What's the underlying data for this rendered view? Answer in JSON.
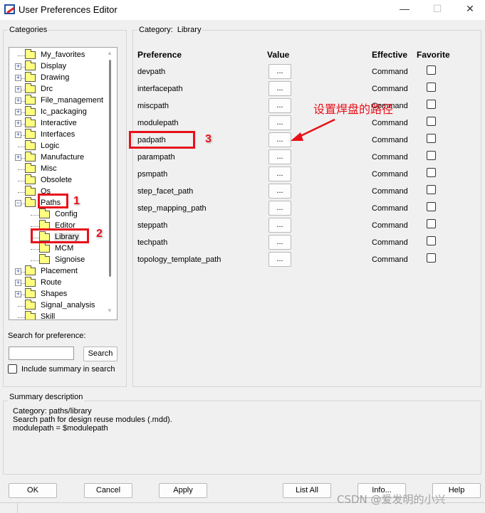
{
  "window": {
    "title": "User Preferences Editor",
    "controls": [
      "—",
      "☐",
      "✕"
    ]
  },
  "categories": {
    "legend": "Categories",
    "items": [
      {
        "label": "My_favorites",
        "level": 0,
        "expander": ""
      },
      {
        "label": "Display",
        "level": 0,
        "expander": "+"
      },
      {
        "label": "Drawing",
        "level": 0,
        "expander": "+"
      },
      {
        "label": "Drc",
        "level": 0,
        "expander": "+"
      },
      {
        "label": "File_management",
        "level": 0,
        "expander": "+"
      },
      {
        "label": "Ic_packaging",
        "level": 0,
        "expander": "+"
      },
      {
        "label": "Interactive",
        "level": 0,
        "expander": "+"
      },
      {
        "label": "Interfaces",
        "level": 0,
        "expander": "+"
      },
      {
        "label": "Logic",
        "level": 0,
        "expander": ""
      },
      {
        "label": "Manufacture",
        "level": 0,
        "expander": "+"
      },
      {
        "label": "Misc",
        "level": 0,
        "expander": ""
      },
      {
        "label": "Obsolete",
        "level": 0,
        "expander": ""
      },
      {
        "label": "Os",
        "level": 0,
        "expander": ""
      },
      {
        "label": "Paths",
        "level": 0,
        "expander": "−"
      },
      {
        "label": "Config",
        "level": 1,
        "expander": ""
      },
      {
        "label": "Editor",
        "level": 1,
        "expander": ""
      },
      {
        "label": "Library",
        "level": 1,
        "expander": "",
        "selected": true
      },
      {
        "label": "MCM",
        "level": 1,
        "expander": ""
      },
      {
        "label": "Signoise",
        "level": 1,
        "expander": ""
      },
      {
        "label": "Placement",
        "level": 0,
        "expander": "+"
      },
      {
        "label": "Route",
        "level": 0,
        "expander": "+"
      },
      {
        "label": "Shapes",
        "level": 0,
        "expander": "+"
      },
      {
        "label": "Signal_analysis",
        "level": 0,
        "expander": ""
      },
      {
        "label": "Skill",
        "level": 0,
        "expander": ""
      }
    ]
  },
  "search": {
    "label": "Search for preference:",
    "value": "",
    "button": "Search",
    "include_summary_label": "Include summary in search",
    "include_summary_checked": false
  },
  "category_panel": {
    "legend_label": "Category:",
    "legend_value": "Library",
    "headers": {
      "preference": "Preference",
      "value": "Value",
      "effective": "Effective",
      "favorite": "Favorite"
    },
    "rows": [
      {
        "name": "devpath",
        "value": "...",
        "effective": "Command",
        "favorite": false
      },
      {
        "name": "interfacepath",
        "value": "...",
        "effective": "Command",
        "favorite": false
      },
      {
        "name": "miscpath",
        "value": "...",
        "effective": "Command",
        "favorite": false
      },
      {
        "name": "modulepath",
        "value": "...",
        "effective": "Command",
        "favorite": false
      },
      {
        "name": "padpath",
        "value": "...",
        "effective": "Command",
        "favorite": false
      },
      {
        "name": "parampath",
        "value": "...",
        "effective": "Command",
        "favorite": false
      },
      {
        "name": "psmpath",
        "value": "...",
        "effective": "Command",
        "favorite": false
      },
      {
        "name": "step_facet_path",
        "value": "...",
        "effective": "Command",
        "favorite": false
      },
      {
        "name": "step_mapping_path",
        "value": "...",
        "effective": "Command",
        "favorite": false
      },
      {
        "name": "steppath",
        "value": "...",
        "effective": "Command",
        "favorite": false
      },
      {
        "name": "techpath",
        "value": "...",
        "effective": "Command",
        "favorite": false
      },
      {
        "name": "topology_template_path",
        "value": "...",
        "effective": "Command",
        "favorite": false
      }
    ]
  },
  "summary": {
    "legend": "Summary description",
    "lines": [
      "Category: paths/library",
      "Search path for design reuse modules (.mdd).",
      "modulepath = $modulepath"
    ]
  },
  "buttons": {
    "ok": "OK",
    "cancel": "Cancel",
    "apply": "Apply",
    "list_all": "List All",
    "info": "Info...",
    "help": "Help"
  },
  "annotations": {
    "step1": "1",
    "step2": "2",
    "step3": "3",
    "note": "设置焊盘的路径",
    "color": "#e8101a"
  },
  "watermark": "CSDN @爱发明的小兴"
}
